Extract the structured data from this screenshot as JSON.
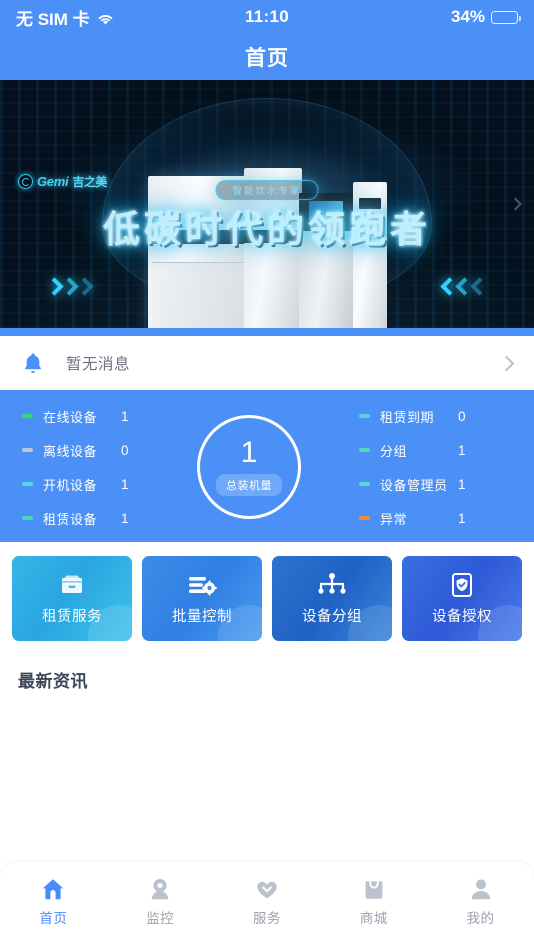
{
  "statusbar": {
    "carrier": "无 SIM 卡",
    "wifi_icon": "wifi-icon",
    "time": "11:10",
    "battery_text": "34%",
    "battery_percent": 34,
    "battery_icon": "battery-icon"
  },
  "navbar": {
    "title": "首页"
  },
  "banner": {
    "logo_en": "Gemi",
    "logo_cn": "吉之美",
    "badge": "智能饮水专家",
    "headline": "低碳时代的领跑者",
    "left_arrow_icon": "chevron-right-glow-icon",
    "right_arrow_icon": "chevron-left-glow-icon",
    "next_icon": "chevron-right-icon"
  },
  "message": {
    "bell_icon": "bell-icon",
    "text": "暂无消息",
    "chevron_icon": "chevron-right-icon"
  },
  "stats": {
    "total": {
      "value": "1",
      "label": "总装机量"
    },
    "left": [
      {
        "label": "在线设备",
        "value": "1",
        "color": "#2fe06a"
      },
      {
        "label": "离线设备",
        "value": "0",
        "color": "#b9c6d6"
      },
      {
        "label": "开机设备",
        "value": "1",
        "color": "#53d9e0"
      },
      {
        "label": "租赁设备",
        "value": "1",
        "color": "#4fd8b0"
      }
    ],
    "right": [
      {
        "label": "租赁到期",
        "value": "0",
        "color": "#5ad3d0"
      },
      {
        "label": "分组",
        "value": "1",
        "color": "#4fd8b8"
      },
      {
        "label": "设备管理员",
        "value": "1",
        "color": "#58d6d2"
      },
      {
        "label": "异常",
        "value": "1",
        "color": "#f58a33"
      }
    ]
  },
  "actions": [
    {
      "label": "租赁服务",
      "icon": "package-box-icon"
    },
    {
      "label": "批量控制",
      "icon": "sliders-gear-icon"
    },
    {
      "label": "设备分组",
      "icon": "hierarchy-tree-icon"
    },
    {
      "label": "设备授权",
      "icon": "shield-check-badge-icon"
    }
  ],
  "news": {
    "title": "最新资讯"
  },
  "tabbar": [
    {
      "label": "首页",
      "icon": "home-icon",
      "active": true
    },
    {
      "label": "监控",
      "icon": "camera-monitor-icon",
      "active": false
    },
    {
      "label": "服务",
      "icon": "heart-service-icon",
      "active": false
    },
    {
      "label": "商城",
      "icon": "shopping-bag-icon",
      "active": false
    },
    {
      "label": "我的",
      "icon": "person-profile-icon",
      "active": false
    }
  ],
  "colors": {
    "brand_blue": "#4a90f7",
    "active_tab": "#4a8cf5",
    "inactive_tab": "#9aa1ab",
    "battery_fill": "#ffcc22"
  }
}
